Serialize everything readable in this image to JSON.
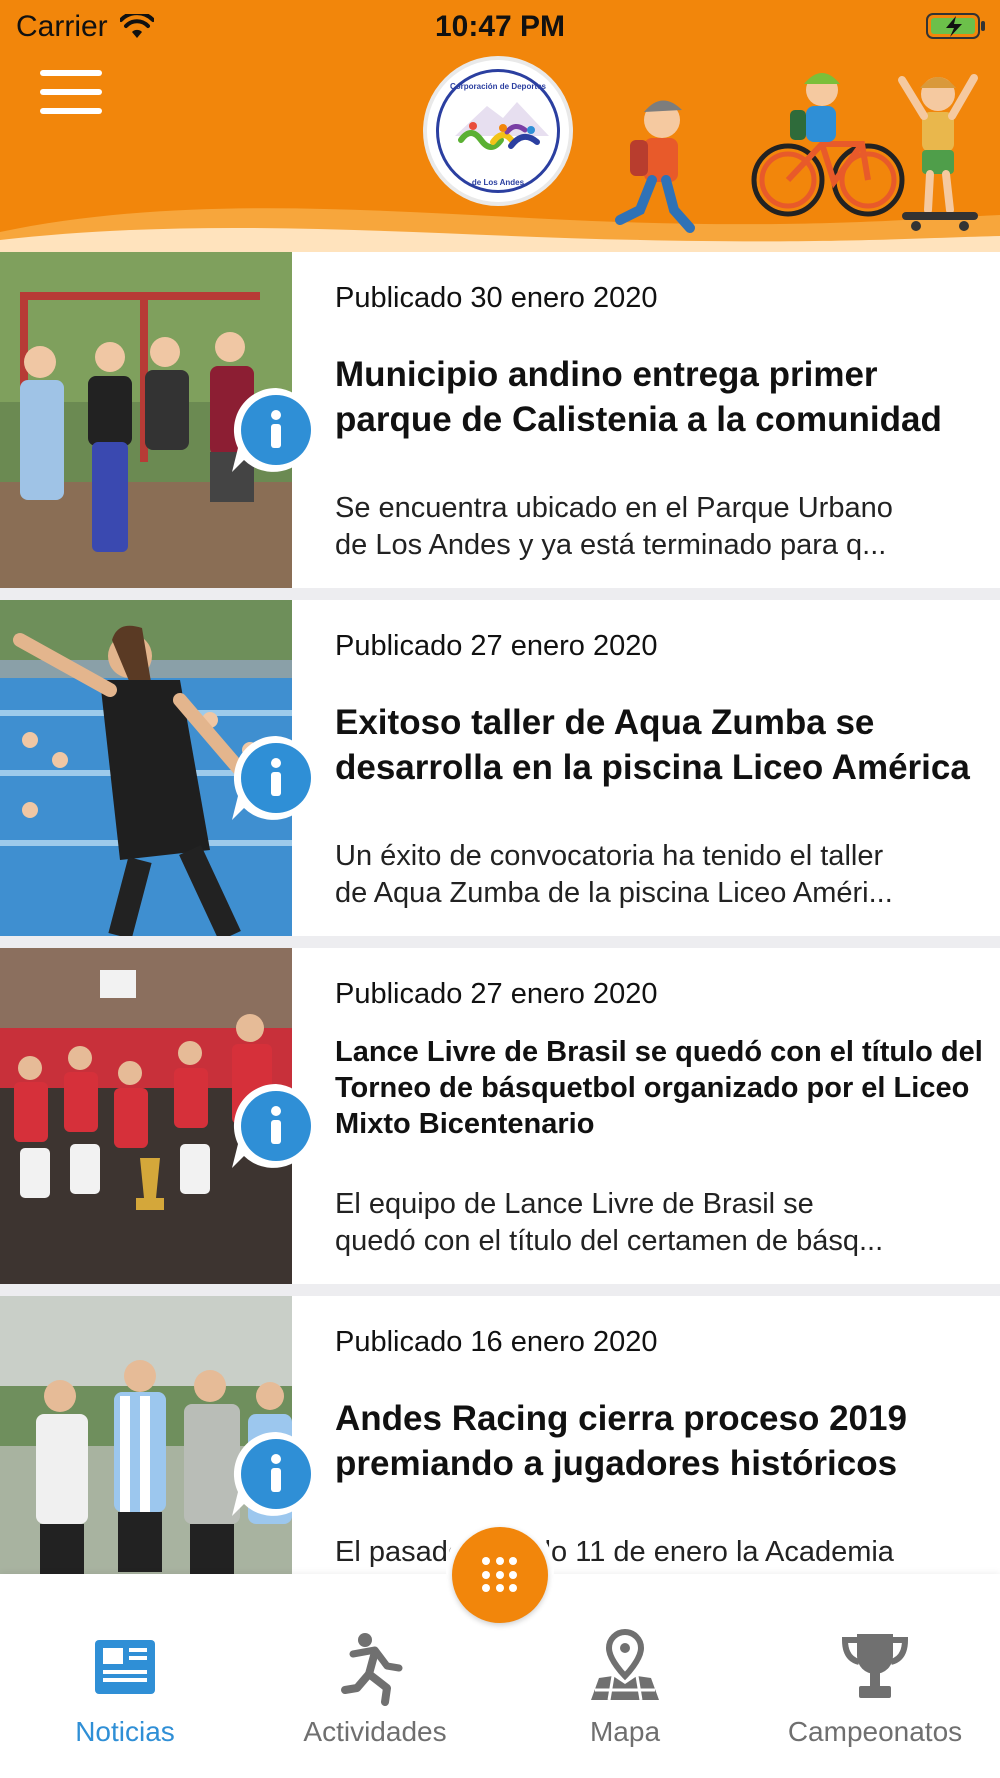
{
  "status_bar": {
    "carrier": "Carrier",
    "time": "10:47 PM"
  },
  "header": {
    "menu_icon": "hamburger-menu-icon",
    "logo": {
      "top_text": "Corporación de Deportes",
      "bottom_text": "de Los Andes"
    },
    "illustration": "kids-sports-illustration",
    "background_color": "#f2860b"
  },
  "news": [
    {
      "date": "Publicado 30 enero 2020",
      "title": "Municipio andino entrega primer parque de Calistenia a la comunidad",
      "summary_lines": [
        "Se encuentra ubicado en el Parque Urbano",
        "de Los Andes y ya está terminado para q..."
      ]
    },
    {
      "date": "Publicado 27 enero 2020",
      "title": "Exitoso taller de Aqua Zumba se desarrolla en la piscina Liceo América",
      "summary_lines": [
        "Un éxito de convocatoria ha tenido el taller",
        "de Aqua Zumba de la piscina Liceo Améri..."
      ]
    },
    {
      "date": "Publicado 27 enero 2020",
      "title": "Lance Livre de Brasil se quedó con el título del Torneo de básquetbol organizado por el Liceo Mixto Bicentenario",
      "summary_lines": [
        "El equipo de Lance Livre de Brasil se",
        "quedó con el título del certamen de básq..."
      ]
    },
    {
      "date": "Publicado 16 enero 2020",
      "title": "Andes Racing cierra proceso 2019 premiando a jugadores históricos",
      "summary_lines": [
        "El pasado sábado 11 de enero la Academia",
        ""
      ]
    }
  ],
  "tabs": [
    {
      "label": "Noticias",
      "icon": "newspaper-icon",
      "active": true
    },
    {
      "label": "Actividades",
      "icon": "runner-icon",
      "active": false
    },
    {
      "label": "Mapa",
      "icon": "map-pin-icon",
      "active": false
    },
    {
      "label": "Campeonatos",
      "icon": "trophy-icon",
      "active": false
    }
  ],
  "fab": {
    "icon": "grid-dots-icon"
  },
  "colors": {
    "accent": "#f2860b",
    "active_tab": "#2f8fd6",
    "info_bubble": "#2f8fd6",
    "inactive_tab": "#6f6f6f"
  }
}
